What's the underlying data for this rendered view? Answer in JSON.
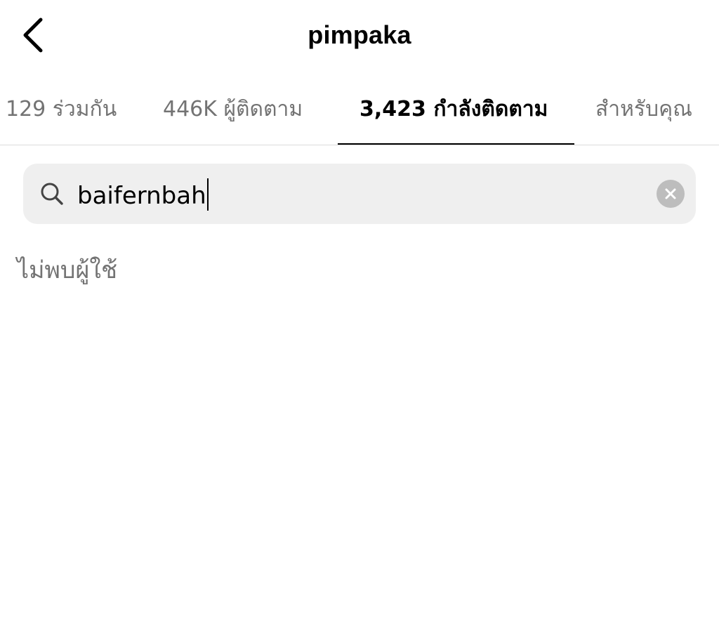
{
  "header": {
    "back_icon": "chevron-left-icon",
    "title": "pimpaka"
  },
  "tabs": [
    {
      "label": "129 ร่วมกัน",
      "active": false
    },
    {
      "label": "446K ผู้ติดตาม",
      "active": false
    },
    {
      "label": "3,423 กำลังติดตาม",
      "active": true
    },
    {
      "label": "สำหรับคุณ",
      "active": false
    }
  ],
  "search": {
    "icon": "search-icon",
    "value": "baifernbah",
    "clear_icon": "clear-circle-icon"
  },
  "results": {
    "empty_message": "ไม่พบผู้ใช้"
  },
  "colors": {
    "text_primary": "#000000",
    "text_secondary": "#737373",
    "search_background": "#efefef",
    "clear_button": "#bdbdbd",
    "divider": "#dbdbdb"
  }
}
